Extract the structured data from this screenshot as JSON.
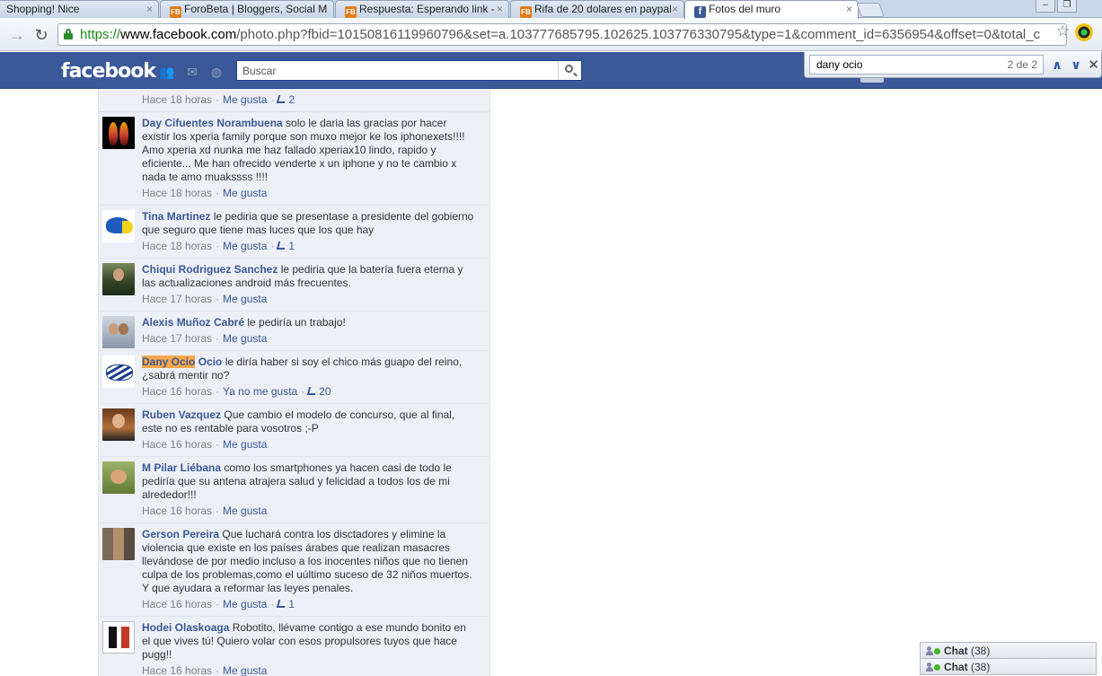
{
  "browser": {
    "tabs": [
      {
        "title": "Shopping! Nice",
        "favicon": "none"
      },
      {
        "title": "ForoBeta | Bloggers, Social M",
        "favicon": "forobeta-icon"
      },
      {
        "title": "Respuesta: Esperando link -",
        "favicon": "forobeta-icon"
      },
      {
        "title": "Rifa de 20 dolares en paypal",
        "favicon": "forobeta-icon"
      },
      {
        "title": "Fotos del muro",
        "favicon": "facebook-icon"
      }
    ],
    "url": {
      "scheme": "https://",
      "host": "www.facebook.com",
      "path": "/photo.php?fbid=10150816119960796&set=a.103777685795.102625.103776330795&type=1&comment_id=6356954&offset=0&total_c"
    }
  },
  "facebook": {
    "logo": "facebook",
    "search_placeholder": "Buscar",
    "brand_color": "#3b5998"
  },
  "findbar": {
    "query": "dany ocio",
    "count": "2 de 2"
  },
  "comments": [
    {
      "name": "",
      "text": "",
      "time": "Hace 18 horas",
      "like_label": "Me gusta",
      "likes": "2",
      "avatar": "dark"
    },
    {
      "name": "Day Cifuentes Norambuena",
      "text": "solo le daria las gracias por hacer existir los xperia family porque son muxo mejor ke los iphonexets!!!! Amo xperia xd nunka me haz fallado xperiax10 lindo, rapido y eficiente... Me han ofrecido venderte x un iphone y no te cambio x nada te amo muakssss !!!!",
      "time": "Hace 18 horas",
      "like_label": "Me gusta",
      "likes": "",
      "avatar": "fire"
    },
    {
      "name": "Tina Martinez",
      "text": "le pediria que se presentase a presidente del gobierno que seguro que tiene mas luces que los que hay",
      "time": "Hace 18 horas",
      "like_label": "Me gusta",
      "likes": "1",
      "avatar": "dory"
    },
    {
      "name": "Chiqui Rodriguez Sanchez",
      "text": "le pediria que la batería fuera eterna y las actualizaciones android más frecuentes.",
      "time": "Hace 17 horas",
      "like_label": "Me gusta",
      "likes": "",
      "avatar": "photo1"
    },
    {
      "name": "Alexis Muñoz Cabré",
      "text": "le pediría un trabajo!",
      "time": "Hace 17 horas",
      "like_label": "Me gusta",
      "likes": "",
      "avatar": "couple"
    },
    {
      "name_highlight": "Dany Ocio",
      "name": " Ocio",
      "text": "le diría haber si soy el chico más guapo del reino, ¿sabrá mentir no?",
      "time": "Hace 16 horas",
      "like_label": "Ya no me gusta",
      "likes": "20",
      "avatar": "crest"
    },
    {
      "name": "Ruben Vazquez",
      "text": "Que cambio el modelo de concurso, que al final, este no es rentable para vosotros ;-P",
      "time": "Hace 16 horas",
      "like_label": "Me gusta",
      "likes": "",
      "avatar": "ruben"
    },
    {
      "name": "M Pilar Liébana",
      "text": "como los smartphones ya hacen casi de todo le pediría que su antena atrajera salud y felicidad a todos los de mi alrededor!!!",
      "time": "Hace 16 horas",
      "like_label": "Me gusta",
      "likes": "",
      "avatar": "pilar"
    },
    {
      "name": "Gerson Pereira",
      "text": "Que luchará contra los disctadores y elimine la violencia que existe en los países árabes que realizan masacres llevándose de por medio incluso a los inocentes niños que no tienen culpa de los problemas,como el uúltimo suceso de 32 niños muertos. Y que ayudara a reformar las leyes penales.",
      "time": "Hace 16 horas",
      "like_label": "Me gusta",
      "likes": "1",
      "avatar": "gerson"
    },
    {
      "name": "Hodei Olaskoaga",
      "text": "Robotito, llévame contigo a ese mundo bonito en el que vives tú! Quiero volar con esos propulsores tuyos que hace pugg!!",
      "time": "Hace 16 horas",
      "like_label": "Me gusta",
      "likes": "",
      "avatar": "hodei"
    }
  ],
  "chat": {
    "label": "Chat",
    "count": "(38)"
  }
}
